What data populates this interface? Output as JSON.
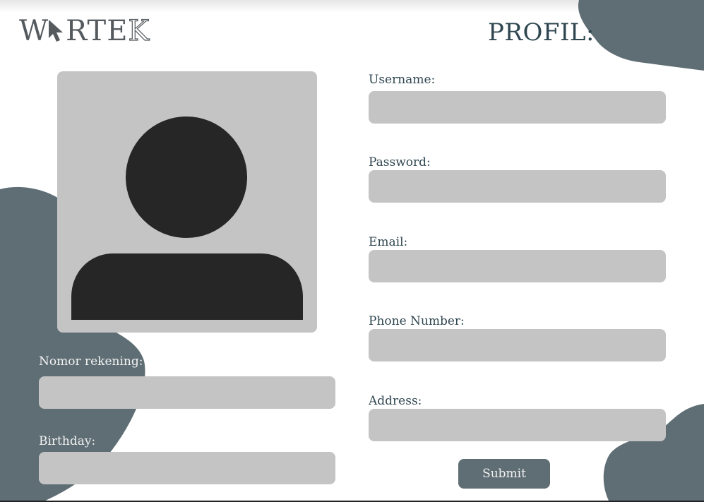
{
  "brand": {
    "logo_text_left": "W",
    "logo_text_right": "RTE",
    "logo_text_outline": "K",
    "color": "#555a5e"
  },
  "page": {
    "title": "PROFIL:",
    "accent_color": "#5f6e75",
    "input_color": "#c4c4c4"
  },
  "avatar": {
    "icon": "user-placeholder-icon"
  },
  "form": {
    "username": {
      "label": "Username:",
      "value": ""
    },
    "password": {
      "label": "Password:",
      "value": ""
    },
    "email": {
      "label": "Email:",
      "value": ""
    },
    "phone": {
      "label": "Phone Number:",
      "value": ""
    },
    "address": {
      "label": "Address:",
      "value": ""
    },
    "account_number": {
      "label": "Nomor rekening:",
      "value": ""
    },
    "birthday": {
      "label": "Birthday:",
      "value": ""
    },
    "submit_label": "Submit"
  }
}
